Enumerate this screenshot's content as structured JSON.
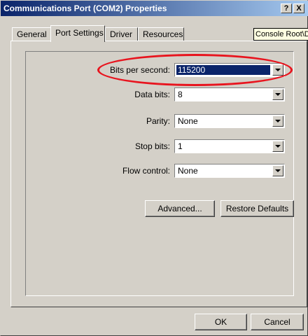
{
  "window": {
    "title": "Communications Port (COM2) Properties",
    "help_button": "?",
    "close_button": "X"
  },
  "tabs": [
    "General",
    "Port Settings",
    "Driver",
    "Resources"
  ],
  "active_tab": "Port Settings",
  "tooltip": "Console Root\\D",
  "settings": {
    "bits_per_second": {
      "label": "Bits per second:",
      "value": "115200"
    },
    "data_bits": {
      "label": "Data bits:",
      "value": "8"
    },
    "parity": {
      "label": "Parity:",
      "value": "None"
    },
    "stop_bits": {
      "label": "Stop bits:",
      "value": "1"
    },
    "flow_control": {
      "label": "Flow control:",
      "value": "None"
    }
  },
  "buttons": {
    "advanced": "Advanced...",
    "restore_defaults": "Restore Defaults",
    "ok": "OK",
    "cancel": "Cancel"
  },
  "colors": {
    "title_bar_start": "#0a246a",
    "title_bar_end": "#a6caf0",
    "dialog_face": "#d4d0c8",
    "selection": "#0a246a",
    "annotation_ellipse": "#e8141e",
    "tooltip_background": "#ffffe1"
  }
}
